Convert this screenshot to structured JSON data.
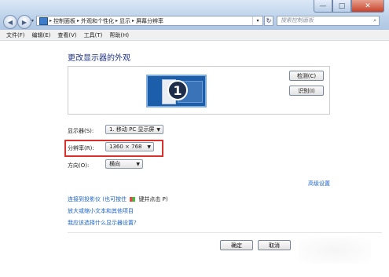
{
  "window": {
    "controls": {
      "minimize": "—",
      "maximize": "□",
      "close": "✕"
    },
    "nav": {
      "back_icon": "arrow-left-icon",
      "forward_icon": "arrow-right-icon",
      "dropdown_icon": "chevron-down-icon"
    }
  },
  "address": {
    "icon": "control-panel-icon",
    "crumbs": [
      "控制面板",
      "外观和个性化",
      "显示",
      "屏幕分辨率"
    ],
    "separator": "▸",
    "dropdown": "▾",
    "refresh": "↻"
  },
  "search": {
    "placeholder": "搜索控制面板",
    "icon": "search-icon"
  },
  "menu": [
    "文件(F)",
    "编辑(E)",
    "查看(V)",
    "工具(T)",
    "帮助(H)"
  ],
  "main": {
    "title": "更改显示器的外观",
    "monitor_number": "1",
    "detect_button": "检测(C)",
    "identify_button": "识别(I)",
    "display_label": "显示器(S):",
    "display_value": "1. 移动 PC 显示屏",
    "resolution_label": "分辨率(R):",
    "resolution_value": "1360 × 768",
    "orientation_label": "方向(O):",
    "orientation_value": "横向",
    "advanced_link": "高级设置",
    "projector_link": "连接到投影仪 (也可按住",
    "projector_suffix": "键并点击 P)",
    "text_size_link": "放大或缩小文本和其他项目",
    "help_link": "我应该选择什么显示器设置?",
    "ok_button": "确定",
    "cancel_button": "取消"
  },
  "colors": {
    "highlight": "#d9302b",
    "link": "#1d63c4",
    "title": "#1e3287"
  }
}
